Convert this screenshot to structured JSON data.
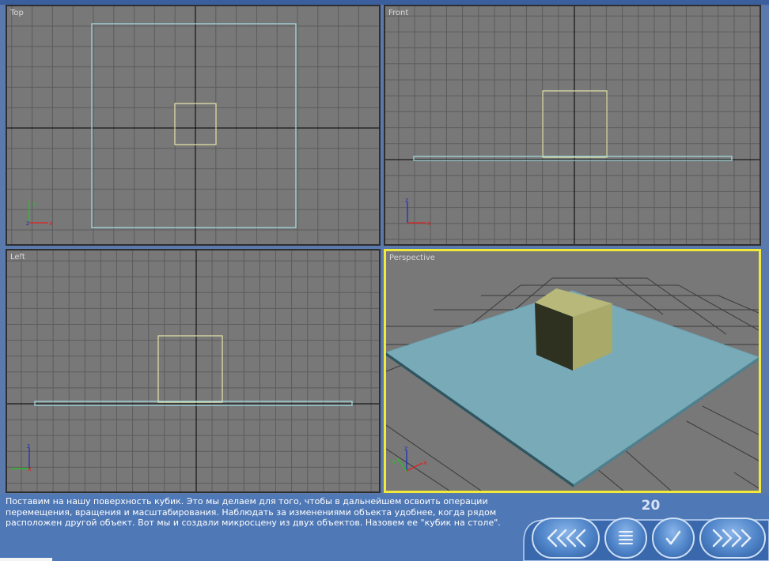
{
  "viewports": {
    "top": {
      "label": "Top"
    },
    "front": {
      "label": "Front"
    },
    "left": {
      "label": "Left"
    },
    "perspective": {
      "label": "Perspective"
    }
  },
  "axes": {
    "top": {
      "vertical": "y",
      "horizontal": "x",
      "center": "z"
    },
    "front": {
      "vertical": "z",
      "horizontal": "x"
    },
    "left": {
      "vertical": "z",
      "horizontal": "x"
    },
    "perspective": {
      "vertical": "z",
      "horizontal": "x",
      "diagonal": "y"
    }
  },
  "colors": {
    "viewport_bg": "#787878",
    "grid": "#5c5c5c",
    "axis_line": "#000000",
    "box_wire": "#e6e5a6",
    "plane_wire": "#a8e0e6",
    "active_border": "#f2ea3a",
    "plane_fill": "#78aab8",
    "cube_top": "#b7b87a",
    "cube_front": "#2e3120",
    "cube_side": "#a9aa6a"
  },
  "caption": {
    "line1": "Поставим на нашу поверхность кубик. Это мы делаем для того, чтобы в дальнейшем освоить операции",
    "line2": "перемещения, вращения и масштабирования. Наблюдать за изменениями объекта удобнее, когда рядом",
    "line3": "расположен другой объект. Вот мы и создали микросцену из двух объектов. Назовем ее \"кубик на столе\"."
  },
  "page_number": "20",
  "nav": {
    "icons": [
      "rewind-icon",
      "menu-icon",
      "check-icon",
      "forward-icon"
    ]
  }
}
